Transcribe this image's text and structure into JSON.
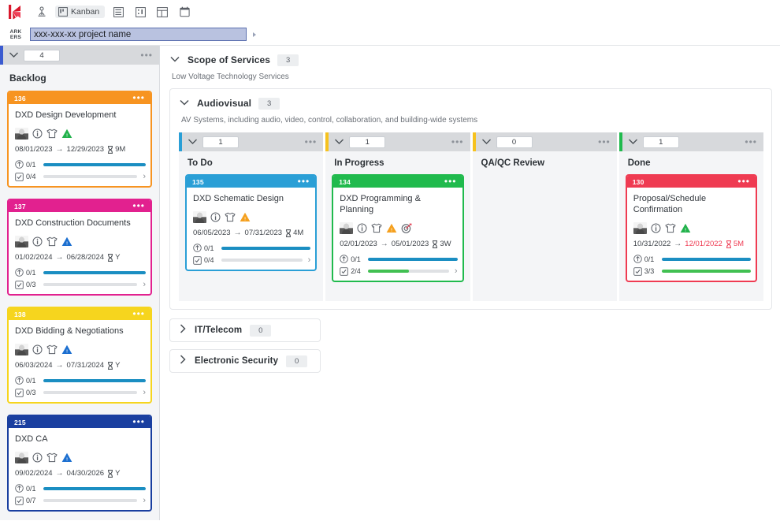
{
  "toolbar": {
    "logo_name": "app-logo",
    "buttons": [
      {
        "name": "person-pin-icon",
        "label": ""
      },
      {
        "name": "kanban-view",
        "label": "Kanban"
      },
      {
        "name": "list-view-icon",
        "label": ""
      },
      {
        "name": "grid-view-icon",
        "label": ""
      },
      {
        "name": "board-layout-icon",
        "label": ""
      },
      {
        "name": "calendar-icon",
        "label": ""
      }
    ]
  },
  "project": {
    "logo_line1": "ARK",
    "logo_line2": "ERS",
    "name_value": "xxx-xxx-xx project name",
    "name_placeholder": "project name"
  },
  "backlog": {
    "count": "4",
    "title": "Backlog",
    "menu": "•••",
    "cards": [
      {
        "id": "136",
        "title": "DXD Design Development",
        "color": "#f79421",
        "start": "08/01/2023",
        "end": "12/29/2023",
        "duration": "9M",
        "late": false,
        "priority": "green",
        "has_target": false,
        "progress_label": "0/1",
        "progress_pct": 100,
        "check_label": "0/4",
        "check_pct": 0
      },
      {
        "id": "137",
        "title": "DXD Construction Documents",
        "color": "#e2218f",
        "start": "01/02/2024",
        "end": "06/28/2024",
        "duration": "Y",
        "late": false,
        "priority": "blue",
        "has_target": false,
        "progress_label": "0/1",
        "progress_pct": 100,
        "check_label": "0/3",
        "check_pct": 0
      },
      {
        "id": "138",
        "title": "DXD Bidding & Negotiations",
        "color": "#f6d51e",
        "start": "06/03/2024",
        "end": "07/31/2024",
        "duration": "Y",
        "late": false,
        "priority": "blue",
        "has_target": false,
        "progress_label": "0/1",
        "progress_pct": 100,
        "check_label": "0/3",
        "check_pct": 0
      },
      {
        "id": "215",
        "title": "DXD CA",
        "color": "#1a3fa0",
        "start": "09/02/2024",
        "end": "04/30/2026",
        "duration": "Y",
        "late": false,
        "priority": "blue",
        "has_target": false,
        "progress_label": "0/1",
        "progress_pct": 100,
        "check_label": "0/7",
        "check_pct": 0
      }
    ]
  },
  "scope": {
    "title": "Scope of Services",
    "count": "3",
    "subtitle": "Low Voltage Technology Services"
  },
  "group": {
    "title": "Audiovisual",
    "count": "3",
    "subtitle": "AV Systems, including audio, video, control, collaboration, and building-wide systems"
  },
  "columns": [
    {
      "title": "To Do",
      "count": "1",
      "accent": "#2a9fd6",
      "cards": [
        {
          "id": "135",
          "title": "DXD Schematic Design",
          "color": "#2a9fd6",
          "start": "06/05/2023",
          "end": "07/31/2023",
          "duration": "4M",
          "late": false,
          "priority": "orange",
          "has_target": false,
          "progress_label": "0/1",
          "progress_pct": 100,
          "check_label": "0/4",
          "check_pct": 0
        }
      ]
    },
    {
      "title": "In Progress",
      "count": "1",
      "accent": "#f6c21e",
      "cards": [
        {
          "id": "134",
          "title": "DXD Programming & Planning",
          "color": "#20ba4d",
          "start": "02/01/2023",
          "end": "05/01/2023",
          "duration": "3W",
          "late": false,
          "priority": "orange",
          "has_target": true,
          "progress_label": "0/1",
          "progress_pct": 100,
          "check_label": "2/4",
          "check_pct": 50
        }
      ]
    },
    {
      "title": "QA/QC Review",
      "count": "0",
      "accent": "#f6c21e",
      "cards": []
    },
    {
      "title": "Done",
      "count": "1",
      "accent": "#20ba4d",
      "cards": [
        {
          "id": "130",
          "title": "Proposal/Schedule Confirmation",
          "color": "#ef3b52",
          "start": "10/31/2022",
          "end": "12/01/2022",
          "duration": "5M",
          "late": true,
          "priority": "green",
          "has_target": false,
          "progress_label": "0/1",
          "progress_pct": 100,
          "check_label": "3/3",
          "check_pct": 100
        }
      ]
    }
  ],
  "collapsed_sections": [
    {
      "title": "IT/Telecom",
      "count": "0"
    },
    {
      "title": "Electronic Security",
      "count": "0"
    }
  ],
  "colors": {
    "progress_blue": "#1b8ec2",
    "progress_green": "#41c052",
    "late_red": "#ef3b52"
  }
}
